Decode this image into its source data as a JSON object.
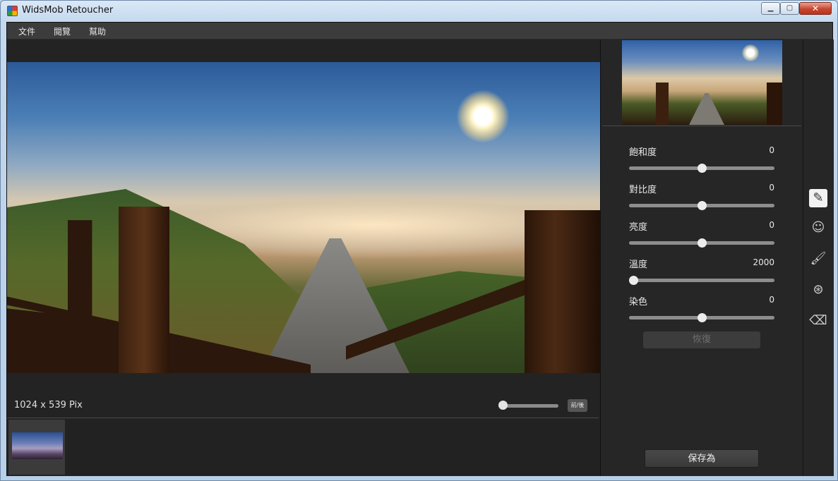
{
  "window": {
    "title": "WidsMob Retoucher",
    "min_glyph": "▁",
    "max_glyph": "▢",
    "close_glyph": "✕"
  },
  "menu": {
    "items": [
      "文件",
      "閱覽",
      "幫助"
    ]
  },
  "canvas": {
    "dimensions": "1024 x 539 Pix",
    "zoom_level": 0.0,
    "fit_label": "前/後"
  },
  "adjust": {
    "sliders": [
      {
        "label": "飽和度",
        "value": "0",
        "level": 0.5
      },
      {
        "label": "對比度",
        "value": "0",
        "level": 0.5
      },
      {
        "label": "亮度",
        "value": "0",
        "level": 0.5
      },
      {
        "label": "溫度",
        "value": "2000",
        "level": 0.0
      },
      {
        "label": "染色",
        "value": "0",
        "level": 0.5
      }
    ],
    "reset_label": "恢復",
    "save_label": "保存為"
  },
  "tools": [
    {
      "name": "pencil-icon",
      "glyph": "✎",
      "active": true
    },
    {
      "name": "face-icon",
      "glyph": "☺",
      "active": false
    },
    {
      "name": "brush-icon",
      "glyph": "🖌",
      "active": false
    },
    {
      "name": "color-circles-icon",
      "glyph": "⊛",
      "active": false
    },
    {
      "name": "eraser-icon",
      "glyph": "⌫",
      "active": false
    }
  ]
}
